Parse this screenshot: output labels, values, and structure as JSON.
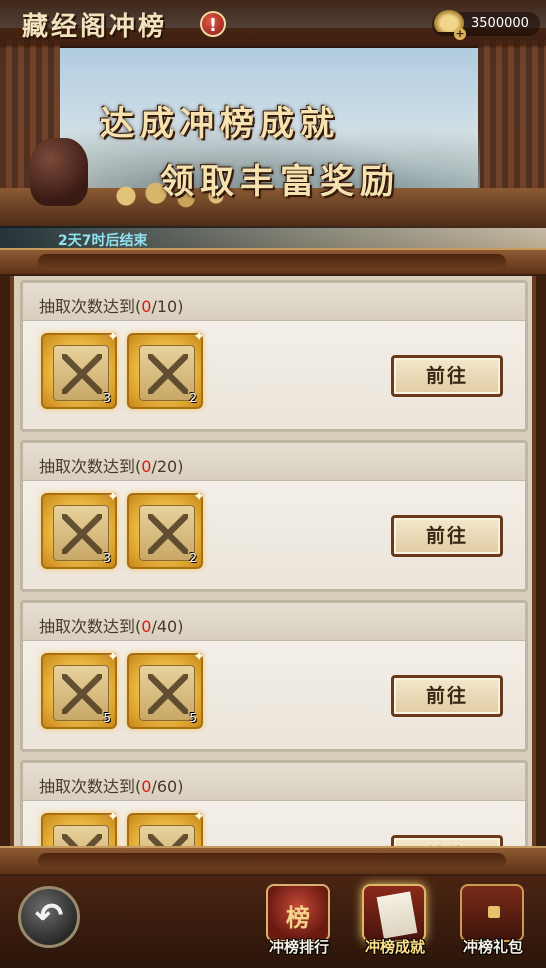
{
  "header": {
    "title": "藏经阁冲榜",
    "info_icon": "exclamation-icon",
    "currency_value": "3500000",
    "currency_icon": "gold-ingot-icon",
    "plus_icon": "plus-icon"
  },
  "banner": {
    "slogan_line1": "达成冲榜成就",
    "slogan_line2": "领取丰富奖励",
    "countdown": "2天7时后结束"
  },
  "achievements": [
    {
      "label": "抽取次数达到",
      "open": "(",
      "current": "0",
      "target": "/10)",
      "rewards": [
        {
          "icon": "scripture-scroll-icon",
          "qty": "3"
        },
        {
          "icon": "scripture-scroll-icon",
          "qty": "2"
        }
      ],
      "button": "前往"
    },
    {
      "label": "抽取次数达到",
      "open": "(",
      "current": "0",
      "target": "/20)",
      "rewards": [
        {
          "icon": "scripture-scroll-icon",
          "qty": "3"
        },
        {
          "icon": "scripture-scroll-icon",
          "qty": "2"
        }
      ],
      "button": "前往"
    },
    {
      "label": "抽取次数达到",
      "open": "(",
      "current": "0",
      "target": "/40)",
      "rewards": [
        {
          "icon": "scripture-scroll-icon",
          "qty": "5"
        },
        {
          "icon": "scripture-scroll-icon",
          "qty": "5"
        }
      ],
      "button": "前往"
    },
    {
      "label": "抽取次数达到",
      "open": "(",
      "current": "0",
      "target": "/60)",
      "rewards": [
        {
          "icon": "scripture-scroll-icon",
          "qty": ""
        },
        {
          "icon": "scripture-scroll-icon",
          "qty": ""
        }
      ],
      "button": "前往"
    }
  ],
  "nav": {
    "back_icon": "back-arrow-icon",
    "tabs": [
      {
        "label": "冲榜排行",
        "icon": "ranking-scroll-icon",
        "active": false
      },
      {
        "label": "冲榜成就",
        "icon": "achievement-book-icon",
        "active": true
      },
      {
        "label": "冲榜礼包",
        "icon": "gift-chest-icon",
        "active": false
      }
    ]
  },
  "colors": {
    "progress_current": "#d21e12",
    "active_tab_label": "#ffe08a",
    "countdown_text": "#8fe3f0"
  }
}
